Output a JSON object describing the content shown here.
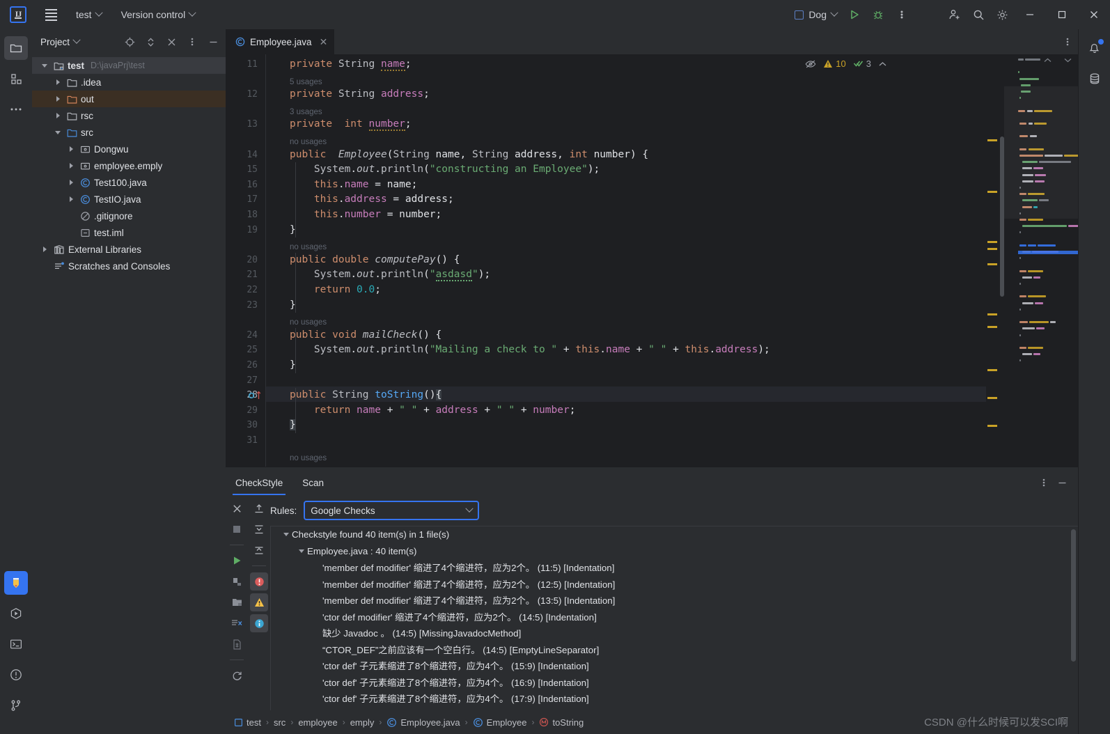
{
  "titlebar": {
    "logo": "IJ",
    "menu_icon": "hamburger-icon",
    "project_name": "test",
    "version_control": "Version control",
    "run_config": "Dog",
    "icons": [
      "run-icon",
      "debug-icon",
      "more-icon",
      "add-user-icon",
      "search-icon",
      "gear-icon"
    ],
    "window": {
      "minimize": "—",
      "maximize": "□",
      "close": "✕"
    }
  },
  "left_stripe": {
    "top": [
      {
        "name": "project-tool-window",
        "icon": "folder-icon",
        "active": true
      },
      {
        "name": "structure-tool-window",
        "icon": "structure-icon",
        "active": false
      },
      {
        "name": "more-tool-windows",
        "icon": "ellipsis-icon",
        "active": false
      }
    ],
    "bottom": [
      {
        "name": "checkstyle-tool-window",
        "icon": "pencil-icon",
        "active": true
      },
      {
        "name": "run-tool-window",
        "icon": "play-hex-icon",
        "active": false
      },
      {
        "name": "terminal-tool-window",
        "icon": "terminal-icon",
        "active": false
      },
      {
        "name": "problems-tool-window",
        "icon": "warning-circle-icon",
        "active": false
      },
      {
        "name": "git-tool-window",
        "icon": "branch-icon",
        "active": false
      }
    ]
  },
  "right_stripe": [
    {
      "name": "notifications",
      "icon": "bell-icon",
      "badge": true
    },
    {
      "name": "database",
      "icon": "database-icon",
      "badge": false
    }
  ],
  "project_panel": {
    "title": "Project",
    "header_icons": [
      "locate-icon",
      "expand-collapse-icon",
      "close-all-icon",
      "options-icon",
      "hide-icon"
    ],
    "tree": [
      {
        "label": "test",
        "path": "D:\\javaPrj\\test",
        "icon": "project-icon",
        "depth": 0,
        "arrow": "open",
        "state": "selected",
        "bold": true
      },
      {
        "label": ".idea",
        "icon": "folder-icon",
        "depth": 1,
        "arrow": "closed",
        "state": "normal"
      },
      {
        "label": "out",
        "icon": "folder-orange-icon",
        "depth": 1,
        "arrow": "closed",
        "state": "highlight"
      },
      {
        "label": "rsc",
        "icon": "folder-icon",
        "depth": 1,
        "arrow": "closed",
        "state": "normal"
      },
      {
        "label": "src",
        "icon": "folder-blue-icon",
        "depth": 1,
        "arrow": "open",
        "state": "normal"
      },
      {
        "label": "Dongwu",
        "icon": "package-icon",
        "depth": 2,
        "arrow": "closed",
        "state": "normal"
      },
      {
        "label": "employee.emply",
        "icon": "package-icon",
        "depth": 2,
        "arrow": "closed",
        "state": "normal"
      },
      {
        "label": "Test100.java",
        "icon": "class-icon",
        "depth": 2,
        "arrow": "closed",
        "state": "normal"
      },
      {
        "label": "TestIO.java",
        "icon": "class-icon",
        "depth": 2,
        "arrow": "closed",
        "state": "normal"
      },
      {
        "label": ".gitignore",
        "icon": "gitignore-icon",
        "depth": 2,
        "arrow": "none",
        "state": "normal"
      },
      {
        "label": "test.iml",
        "icon": "iml-icon",
        "depth": 2,
        "arrow": "none",
        "state": "normal"
      },
      {
        "label": "External Libraries",
        "icon": "library-icon",
        "depth": 0,
        "arrow": "closed",
        "state": "normal"
      },
      {
        "label": "Scratches and Consoles",
        "icon": "scratch-icon",
        "depth": 0,
        "arrow": "none",
        "state": "normal"
      }
    ]
  },
  "editor": {
    "tab": {
      "label": "Employee.java",
      "icon": "class-icon",
      "close": "✕"
    },
    "inspection_widget": {
      "eye_icon": "eye-off-icon",
      "warning_icon": "warning-triangle-icon",
      "warning_count": "10",
      "weak_icon": "weak-warning-icon",
      "weak_count": "3",
      "collapse_icon": "chevron-up-icon"
    },
    "first_line_number": 11,
    "current_line": 28,
    "lines": [
      {
        "n": 11,
        "t": "code"
      },
      {
        "n": null,
        "t": "usage",
        "text": "5 usages"
      },
      {
        "n": 12,
        "t": "code"
      },
      {
        "n": null,
        "t": "usage",
        "text": "3 usages"
      },
      {
        "n": 13,
        "t": "code"
      },
      {
        "n": null,
        "t": "usage",
        "text": "no usages"
      },
      {
        "n": 14,
        "t": "code"
      },
      {
        "n": 15,
        "t": "code"
      },
      {
        "n": 16,
        "t": "code"
      },
      {
        "n": 17,
        "t": "code"
      },
      {
        "n": 18,
        "t": "code"
      },
      {
        "n": 19,
        "t": "code"
      },
      {
        "n": null,
        "t": "usage",
        "text": "no usages"
      },
      {
        "n": 20,
        "t": "code"
      },
      {
        "n": 21,
        "t": "code"
      },
      {
        "n": 22,
        "t": "code"
      },
      {
        "n": 23,
        "t": "code"
      },
      {
        "n": null,
        "t": "usage",
        "text": "no usages"
      },
      {
        "n": 24,
        "t": "code"
      },
      {
        "n": 25,
        "t": "code"
      },
      {
        "n": 26,
        "t": "code"
      },
      {
        "n": 27,
        "t": "code"
      },
      {
        "n": 28,
        "t": "code"
      },
      {
        "n": 29,
        "t": "code"
      },
      {
        "n": 30,
        "t": "code"
      },
      {
        "n": 31,
        "t": "code"
      },
      {
        "n": null,
        "t": "usage",
        "text": "no usages"
      }
    ],
    "source_text": "private String name;\nprivate String address;\nprivate  int number;\npublic  Employee(String name, String address, int number) {\n    System.out.println(\"constructing an Employee\");\n    this.name = name;\n    this.address = address;\n    this.number = number;\n}\npublic double computePay() {\n    System.out.println(\"asdasd\");\n    return 0.0;\n}\npublic void mailCheck() {\n    System.out.println(\"Mailing a check to \" + this.name + \" \" + this.address);\n}\n\npublic String toString(){\n    return name + \" \" + address + \" \" + number;\n}\n"
  },
  "checkstyle": {
    "tabs": [
      {
        "label": "CheckStyle",
        "active": true
      },
      {
        "label": "Scan",
        "active": false
      }
    ],
    "header_icons": [
      "options-icon",
      "hide-icon"
    ],
    "toolbar_left": [
      "close-icon",
      "stop-icon",
      "run-scan-icon",
      "scan-module-icon",
      "scan-directory-icon",
      "scan-changes-icon",
      "scan-file-icon",
      "refresh-icon"
    ],
    "toolbar_right": [
      "expand-all-icon",
      "collapse-all-icon",
      "collapse-level-icon",
      "error-filter-icon",
      "warning-filter-icon",
      "info-filter-icon"
    ],
    "rules_label": "Rules:",
    "rules_value": "Google Checks",
    "results": [
      {
        "depth": 0,
        "arrow": "open",
        "text": "Checkstyle found 40 item(s) in 1 file(s)"
      },
      {
        "depth": 1,
        "arrow": "open",
        "text": "Employee.java : 40 item(s)"
      },
      {
        "depth": 2,
        "arrow": "none",
        "text": "'member def modifier' 缩进了4个缩进符，应为2个。  (11:5) [Indentation]"
      },
      {
        "depth": 2,
        "arrow": "none",
        "text": "'member def modifier' 缩进了4个缩进符，应为2个。  (12:5) [Indentation]"
      },
      {
        "depth": 2,
        "arrow": "none",
        "text": "'member def modifier' 缩进了4个缩进符，应为2个。  (13:5) [Indentation]"
      },
      {
        "depth": 2,
        "arrow": "none",
        "text": "'ctor def modifier' 缩进了4个缩进符，应为2个。  (14:5) [Indentation]"
      },
      {
        "depth": 2,
        "arrow": "none",
        "text": "缺少 Javadoc 。  (14:5) [MissingJavadocMethod]"
      },
      {
        "depth": 2,
        "arrow": "none",
        "text": "“CTOR_DEF”之前应该有一个空白行。  (14:5) [EmptyLineSeparator]"
      },
      {
        "depth": 2,
        "arrow": "none",
        "text": "'ctor def' 子元素缩进了8个缩进符，应为4个。  (15:9) [Indentation]"
      },
      {
        "depth": 2,
        "arrow": "none",
        "text": "'ctor def' 子元素缩进了8个缩进符，应为4个。  (16:9) [Indentation]"
      },
      {
        "depth": 2,
        "arrow": "none",
        "text": "'ctor def' 子元素缩进了8个缩进符，应为4个。  (17:9) [Indentation]"
      }
    ]
  },
  "breadcrumb": [
    {
      "label": "test",
      "icon": "module-icon"
    },
    {
      "label": "src",
      "icon": "none"
    },
    {
      "label": "employee",
      "icon": "none"
    },
    {
      "label": "emply",
      "icon": "none"
    },
    {
      "label": "Employee.java",
      "icon": "class-icon"
    },
    {
      "label": "Employee",
      "icon": "class-icon"
    },
    {
      "label": "toString",
      "icon": "method-icon"
    }
  ],
  "watermark": "CSDN @什么时候可以发SCI啊",
  "colors": {
    "bg": "#1e1f22",
    "panel": "#2b2d30",
    "accent": "#3574f0",
    "selection": "#393b40",
    "highlight_row": "#3b2f23",
    "keyword": "#cf8e6d",
    "string": "#6aab73",
    "number": "#2aacb8",
    "field": "#c77dbb",
    "method": "#56a8f5",
    "warning": "#c9a227",
    "error": "#db5c5c",
    "green": "#6aab73"
  }
}
